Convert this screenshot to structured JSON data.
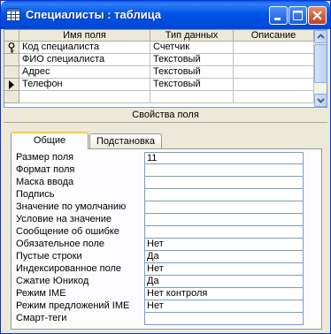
{
  "window": {
    "title": "Специалисты : таблица"
  },
  "grid": {
    "headers": {
      "field_name": "Имя поля",
      "data_type": "Тип данных",
      "description": "Описание"
    },
    "rows": [
      {
        "field_name": "Код специалиста",
        "data_type": "Счетчик",
        "description": "",
        "indicator": "key-icon"
      },
      {
        "field_name": "ФИО специалиста",
        "data_type": "Текстовый",
        "description": "",
        "indicator": ""
      },
      {
        "field_name": "Адрес",
        "data_type": "Текстовый",
        "description": "",
        "indicator": ""
      },
      {
        "field_name": "Телефон",
        "data_type": "Текстовый",
        "description": "",
        "indicator": "current-row-arrow-icon"
      },
      {
        "field_name": "",
        "data_type": "",
        "description": "",
        "indicator": ""
      },
      {
        "field_name": "",
        "data_type": "",
        "description": "",
        "indicator": ""
      }
    ]
  },
  "properties": {
    "caption": "Свойства поля",
    "tabs": {
      "general": "Общие",
      "lookup": "Подстановка"
    },
    "rows": [
      {
        "label": "Размер поля",
        "value": "11"
      },
      {
        "label": "Формат поля",
        "value": ""
      },
      {
        "label": "Маска ввода",
        "value": ""
      },
      {
        "label": "Подпись",
        "value": ""
      },
      {
        "label": "Значение по умолчанию",
        "value": ""
      },
      {
        "label": "Условие на значение",
        "value": ""
      },
      {
        "label": "Сообщение об ошибке",
        "value": ""
      },
      {
        "label": "Обязательное поле",
        "value": "Нет"
      },
      {
        "label": "Пустые строки",
        "value": "Да"
      },
      {
        "label": "Индексированное поле",
        "value": "Нет"
      },
      {
        "label": "Сжатие Юникод",
        "value": "Да"
      },
      {
        "label": "Режим IME",
        "value": "Нет контроля"
      },
      {
        "label": "Режим предложений IME",
        "value": "Нет"
      },
      {
        "label": "Смарт-теги",
        "value": ""
      }
    ]
  },
  "colors": {
    "titlebar": "#0055e5",
    "window_bg": "#ece9d8",
    "active_tab_accent": "#ffc83c"
  }
}
